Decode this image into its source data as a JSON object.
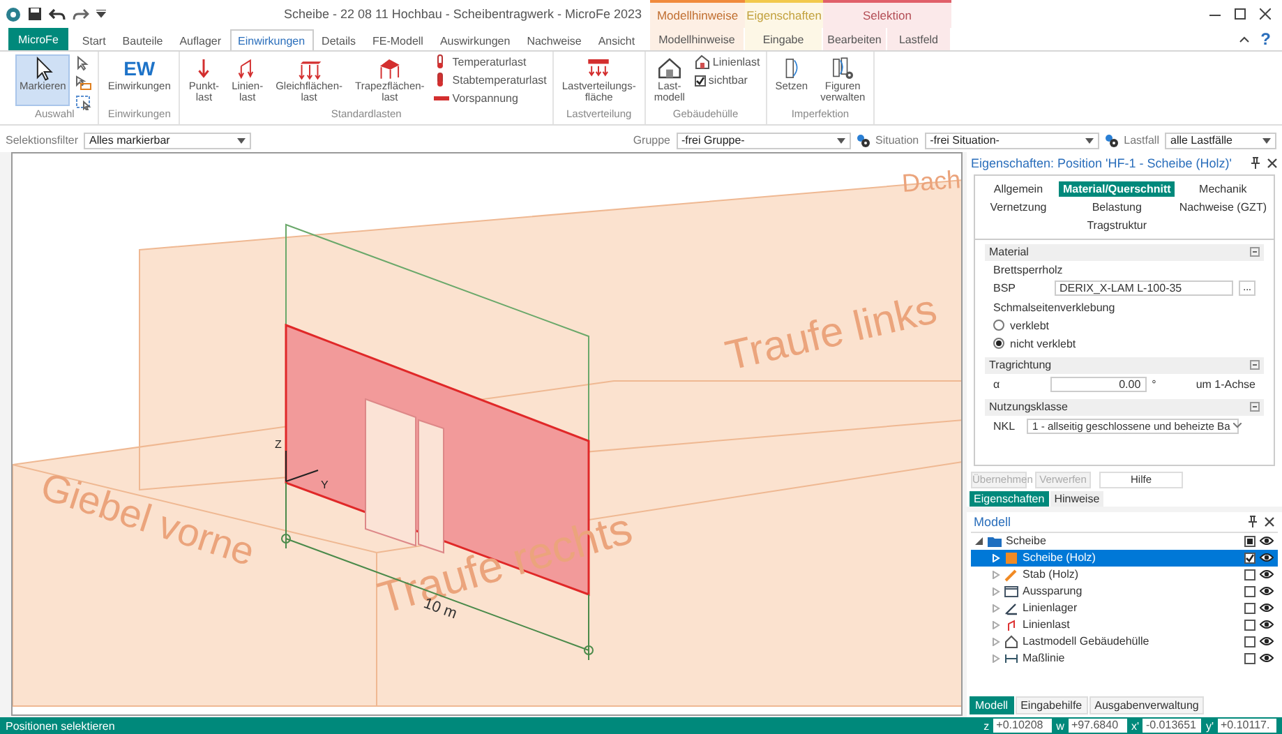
{
  "title_bar": {
    "title": "Scheibe - 22 08 11 Hochbau - Scheibentragwerk - MicroFe 2023",
    "help": "?",
    "app_menu": "MicroFe"
  },
  "tabs": [
    {
      "label": "Start",
      "selected": false
    },
    {
      "label": "Bauteile",
      "selected": false
    },
    {
      "label": "Auflager",
      "selected": false
    },
    {
      "label": "Einwirkungen",
      "selected": true
    },
    {
      "label": "Details",
      "selected": false
    },
    {
      "label": "FE-Modell",
      "selected": false
    },
    {
      "label": "Auswirkungen",
      "selected": false
    },
    {
      "label": "Nachweise",
      "selected": false
    },
    {
      "label": "Ansicht",
      "selected": false
    }
  ],
  "context_groups": [
    {
      "label": "Modellhinweise",
      "color": "#f08a3c",
      "tabs": [
        {
          "label": "Modellhinweise",
          "selected": false
        }
      ]
    },
    {
      "label": "Eigenschaften",
      "color": "#f2c94c",
      "tabs": [
        {
          "label": "Eingabe",
          "selected": false
        }
      ]
    },
    {
      "label": "Selektion",
      "color": "#e0606a",
      "tabs": [
        {
          "label": "Bearbeiten",
          "selected": false
        },
        {
          "label": "Lastfeld",
          "selected": false
        }
      ]
    }
  ],
  "ribbon": [
    {
      "label": "Auswahl",
      "items": [
        {
          "kind": "large",
          "label": "Markieren",
          "selected": true
        },
        {
          "kind": "icon"
        },
        {
          "kind": "icon"
        },
        {
          "kind": "icon"
        }
      ]
    },
    {
      "label": "Einwirkungen",
      "items": [
        {
          "kind": "glyph",
          "glyph": "EW",
          "label": "Einwirkungen"
        }
      ]
    },
    {
      "label": "Standardlasten",
      "items": [
        {
          "kind": "large",
          "label": "Punkt-\nlast",
          "selected": false
        },
        {
          "kind": "large",
          "label": "Linien-\nlast",
          "selected": false
        },
        {
          "kind": "large",
          "label": "Gleichflächen-\nlast",
          "selected": false
        },
        {
          "kind": "large",
          "label": "Trapezflächen-\nlast",
          "selected": false
        },
        {
          "kind": "small",
          "label": "Temperaturlast"
        },
        {
          "kind": "small",
          "label": "Stabtemperaturlast"
        },
        {
          "kind": "small",
          "label": "Vorspannung"
        }
      ]
    },
    {
      "label": "Lastverteilung",
      "items": [
        {
          "kind": "large",
          "label": "Lastverteilungs-\nfläche",
          "selected": false
        }
      ]
    },
    {
      "label": "Gebäudehülle",
      "items": [
        {
          "kind": "large",
          "label": "Last-\nmodell",
          "selected": false
        },
        {
          "kind": "small",
          "label": "Linienlast"
        },
        {
          "kind": "check",
          "label": "sichtbar",
          "checked": true
        }
      ]
    },
    {
      "label": "Imperfektion",
      "items": [
        {
          "kind": "large",
          "label": "Setzen",
          "selected": false
        },
        {
          "kind": "large",
          "label": "Figuren\nverwalten",
          "selected": false
        }
      ]
    }
  ],
  "filters": [
    {
      "label": "Selektionsfilter",
      "value": "Alles markierbar"
    },
    {
      "label": "Gruppe",
      "value": "-frei Gruppe-"
    },
    {
      "label": "Situation",
      "value": "-frei Situation-"
    },
    {
      "label": "Lastfall",
      "value": "alle Lastfälle"
    }
  ],
  "viewport": {
    "labels": [
      {
        "text": "Dach"
      },
      {
        "text": "Traufe links"
      },
      {
        "text": "Giebel vorne"
      },
      {
        "text": "Traufe rechts"
      }
    ],
    "dimension": "10 m",
    "axes": [
      "Z",
      "Y"
    ]
  },
  "properties": {
    "title": "Eigenschaften: Position 'HF-1 - Scheibe (Holz)'",
    "tabs": [
      {
        "label": "Allgemein",
        "selected": false
      },
      {
        "label": "Material/Querschnitt",
        "selected": true
      },
      {
        "label": "Mechanik",
        "selected": false
      },
      {
        "label": "Vernetzung",
        "selected": false
      },
      {
        "label": "Belastung",
        "selected": false
      },
      {
        "label": "Nachweise (GZT)",
        "selected": false
      },
      {
        "label": "Tragstruktur",
        "selected": false
      }
    ],
    "sections": [
      {
        "title": "Material",
        "rows": [
          {
            "kind": "note",
            "text": "Brettsperrholz"
          },
          {
            "kind": "field",
            "label": "BSP",
            "value": "DERIX_X-LAM L-100-35",
            "button": "..."
          },
          {
            "kind": "note",
            "text": "Schmalseitenverklebung"
          },
          {
            "kind": "radio",
            "label": "verklebt",
            "selected": false
          },
          {
            "kind": "radio",
            "label": "nicht verklebt",
            "selected": true
          }
        ]
      },
      {
        "title": "Tragrichtung",
        "rows": [
          {
            "kind": "number",
            "label": "α",
            "value": "0.00",
            "unit": "°",
            "note": "um 1-Achse"
          }
        ]
      },
      {
        "title": "Nutzungsklasse",
        "rows": [
          {
            "kind": "select",
            "label": "NKL",
            "value": "1 - allseitig geschlossene und beheizte Ba"
          }
        ]
      }
    ],
    "buttons": [
      {
        "label": "Übernehmen",
        "disabled": true
      },
      {
        "label": "Verwerfen",
        "disabled": true
      },
      {
        "label": "Hilfe",
        "disabled": false
      }
    ],
    "panel_tabs": [
      {
        "label": "Eigenschaften",
        "selected": true
      },
      {
        "label": "Hinweise",
        "selected": false
      }
    ]
  },
  "model": {
    "title": "Modell",
    "items": [
      {
        "label": "Scheibe",
        "kind": "group",
        "expanded": true,
        "selected": false,
        "checked": true,
        "children": [
          {
            "label": "Scheibe (Holz)",
            "expanded": false,
            "selected": true,
            "checked": true
          },
          {
            "label": "Stab (Holz)",
            "expanded": false,
            "selected": false,
            "checked": false
          },
          {
            "label": "Aussparung",
            "expanded": false,
            "selected": false,
            "checked": false
          },
          {
            "label": "Linienlager",
            "expanded": false,
            "selected": false,
            "checked": false
          },
          {
            "label": "Linienlast",
            "expanded": false,
            "selected": false,
            "checked": false
          },
          {
            "label": "Lastmodell Gebäudehülle",
            "expanded": false,
            "selected": false,
            "checked": false
          },
          {
            "label": "Maßlinie",
            "expanded": false,
            "selected": false,
            "checked": false
          }
        ]
      }
    ],
    "tabs": [
      {
        "label": "Modell",
        "selected": true
      },
      {
        "label": "Eingabehilfe",
        "selected": false
      },
      {
        "label": "Ausgabenverwaltung",
        "selected": false
      }
    ]
  },
  "status_bar": {
    "message": "Positionen selektieren",
    "coords": [
      {
        "label": "z",
        "value": "+0.10208"
      },
      {
        "label": "w",
        "value": "+97.6840"
      },
      {
        "label": "x'",
        "value": "-0.013651"
      },
      {
        "label": "y'",
        "value": "+0.10117."
      }
    ]
  }
}
